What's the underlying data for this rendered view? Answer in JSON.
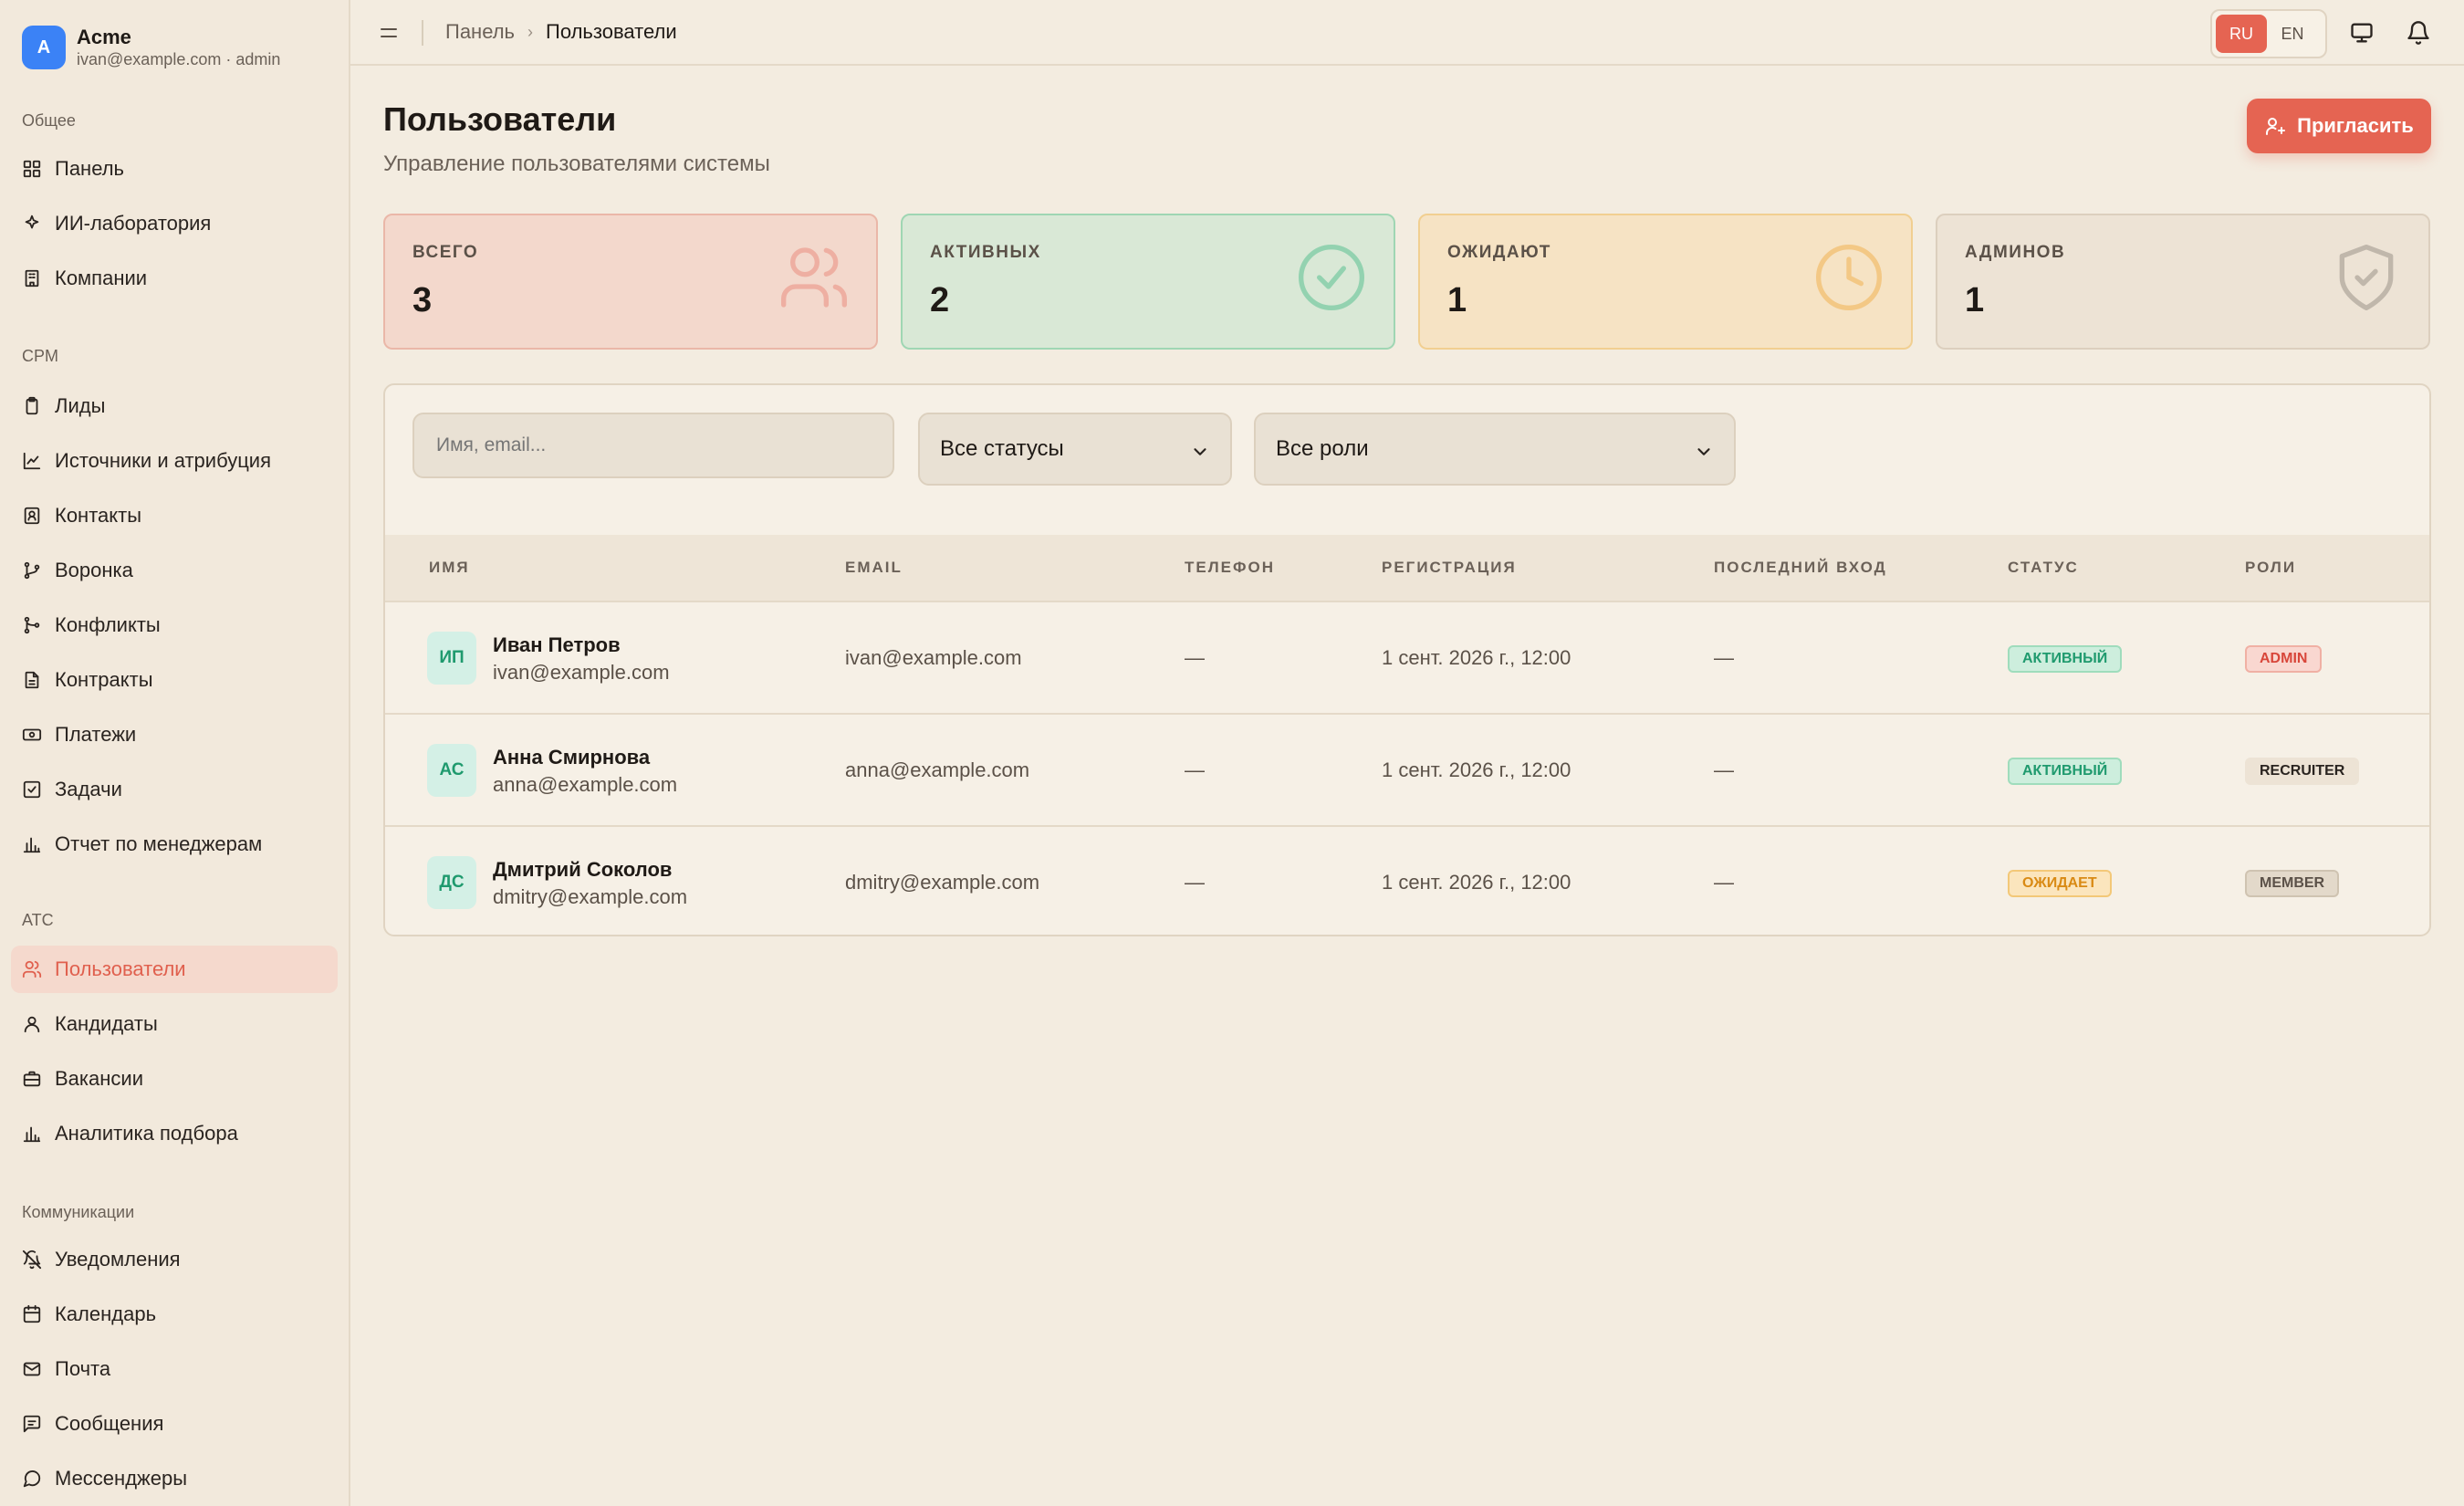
{
  "brand": {
    "initial": "A",
    "name": "Acme",
    "user": "ivan@example.com · admin"
  },
  "sidebar": {
    "sections": [
      "Общее",
      "CPM",
      "ATC",
      "Коммуникации"
    ],
    "items": [
      {
        "label": "Панель",
        "icon": "grid-icon"
      },
      {
        "label": "ИИ-лаборатория",
        "icon": "sparkles-icon"
      },
      {
        "label": "Компании",
        "icon": "building-icon"
      },
      {
        "label": "Лиды",
        "icon": "clipboard-icon"
      },
      {
        "label": "Источники и атрибуция",
        "icon": "chart-line-icon"
      },
      {
        "label": "Контакты",
        "icon": "contact-icon"
      },
      {
        "label": "Воронка",
        "icon": "git-branch-icon"
      },
      {
        "label": "Конфликты",
        "icon": "git-merge-icon"
      },
      {
        "label": "Контракты",
        "icon": "file-icon"
      },
      {
        "label": "Платежи",
        "icon": "banknote-icon"
      },
      {
        "label": "Задачи",
        "icon": "check-square-icon"
      },
      {
        "label": "Отчет по менеджерам",
        "icon": "bar-chart-icon"
      },
      {
        "label": "Пользователи",
        "icon": "users-icon",
        "active": true
      },
      {
        "label": "Кандидаты",
        "icon": "user-icon"
      },
      {
        "label": "Вакансии",
        "icon": "briefcase-icon"
      },
      {
        "label": "Аналитика подбора",
        "icon": "bar-chart-icon"
      },
      {
        "label": "Уведомления",
        "icon": "bell-off-icon"
      },
      {
        "label": "Календарь",
        "icon": "calendar-icon"
      },
      {
        "label": "Почта",
        "icon": "mail-icon"
      },
      {
        "label": "Сообщения",
        "icon": "message-square-icon"
      },
      {
        "label": "Мессенджеры",
        "icon": "message-circle-icon"
      }
    ]
  },
  "topbar": {
    "breadcrumb": [
      "Панель",
      "Пользователи"
    ],
    "lang": [
      "RU",
      "EN"
    ],
    "active_lang": "RU"
  },
  "page": {
    "title": "Пользователи",
    "subtitle": "Управление пользователями системы",
    "invite_label": "Пригласить"
  },
  "stats": [
    {
      "label": "ВСЕГО",
      "value": "3",
      "icon": "users-icon",
      "color": "#e56452"
    },
    {
      "label": "АКТИВНЫХ",
      "value": "2",
      "icon": "check-circle-icon",
      "color": "#3fb982"
    },
    {
      "label": "ОЖИДАЮТ",
      "value": "1",
      "icon": "clock-icon",
      "color": "#f0a63a"
    },
    {
      "label": "АДМИНОВ",
      "value": "1",
      "icon": "shield-check-icon",
      "color": "#8a8078"
    }
  ],
  "filters": {
    "search_placeholder": "Имя, email...",
    "status_value": "Все статусы",
    "role_value": "Все роли"
  },
  "table": {
    "columns": [
      "ИМЯ",
      "EMAIL",
      "ТЕЛЕФОН",
      "РЕГИСТРАЦИЯ",
      "ПОСЛЕДНИЙ ВХОД",
      "СТАТУС",
      "РОЛИ"
    ],
    "rows": [
      {
        "initials": "ИП",
        "name": "Иван Петров",
        "email_sub": "ivan@example.com",
        "email": "ivan@example.com",
        "phone": "—",
        "registered": "1 сент. 2026 г., 12:00",
        "last_login": "—",
        "status": "АКТИВНЫЙ",
        "status_kind": "active",
        "role": "ADMIN",
        "role_kind": "admin"
      },
      {
        "initials": "АС",
        "name": "Анна Смирнова",
        "email_sub": "anna@example.com",
        "email": "anna@example.com",
        "phone": "—",
        "registered": "1 сент. 2026 г., 12:00",
        "last_login": "—",
        "status": "АКТИВНЫЙ",
        "status_kind": "active",
        "role": "RECRUITER",
        "role_kind": "recruiter"
      },
      {
        "initials": "ДС",
        "name": "Дмитрий Соколов",
        "email_sub": "dmitry@example.com",
        "email": "dmitry@example.com",
        "phone": "—",
        "registered": "1 сент. 2026 г., 12:00",
        "last_login": "—",
        "status": "ОЖИДАЕТ",
        "status_kind": "pending",
        "role": "MEMBER",
        "role_kind": "member"
      }
    ]
  }
}
